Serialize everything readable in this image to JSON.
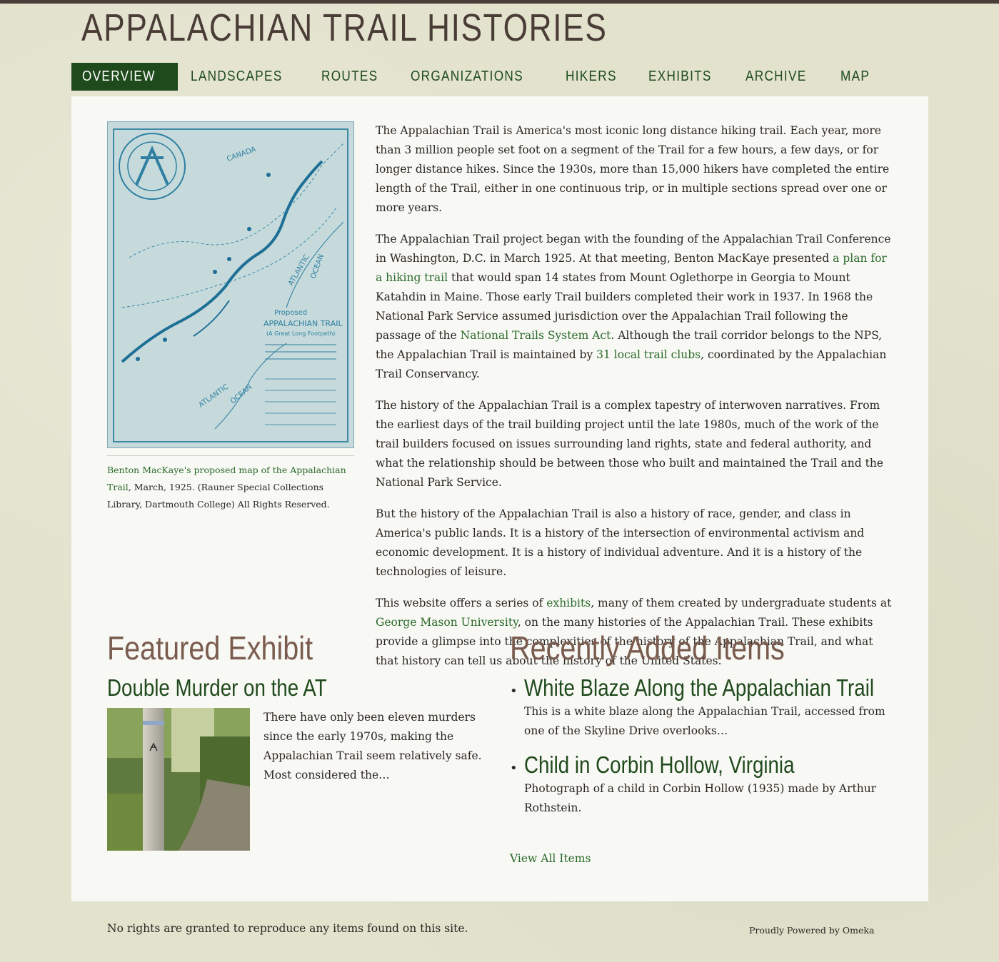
{
  "site": {
    "title": "APPALACHIAN TRAIL HISTORIES"
  },
  "nav": {
    "items": [
      {
        "label": "OVERVIEW"
      },
      {
        "label": "LANDSCAPES"
      },
      {
        "label": "ROUTES"
      },
      {
        "label": "ORGANIZATIONS"
      },
      {
        "label": "HIKERS"
      },
      {
        "label": "EXHIBITS"
      },
      {
        "label": "ARCHIVE"
      },
      {
        "label": "MAP"
      }
    ]
  },
  "map_figure": {
    "map_labels": {
      "canada": "CANADA",
      "proposed": "Proposed",
      "at": "APPALACHIAN TRAIL",
      "subtitle": "(A Great Long Footpath)",
      "atlantic1": "ATLANTIC",
      "ocean1": "OCEAN",
      "atlantic2": "ATLANTIC",
      "ocean2": "OCEAN"
    },
    "caption_link": "Benton MacKaye's proposed map of the Appalachian Trail",
    "caption_rest": ", March, 1925. (Rauner Special Collections Library, Dartmouth College) All Rights Reserved."
  },
  "intro": {
    "p1": "The Appalachian Trail is America's most iconic long distance hiking trail. Each year, more than 3 million people set foot on a segment of the Trail for a few hours, a few days, or for longer distance hikes. Since the 1930s, more than 15,000 hikers have completed the entire length of the Trail, either in one continuous trip, or in multiple sections spread over one or more years.",
    "p2": {
      "a": "The Appalachian Trail project began with the founding of the Appalachian Trail Conference in Washington, D.C. in March 1925. At that meeting, Benton MacKaye presented ",
      "link1": "a plan for a hiking trail",
      "b": " that would span 14 states from Mount Oglethorpe in Georgia to Mount Katahdin in Maine. Those early Trail builders completed their work in 1937. In 1968 the National Park Service assumed jurisdiction over the Appalachian Trail following the passage of the ",
      "link2": "National Trails System Act",
      "c": ". Although the trail corridor belongs to the NPS, the Appalachian Trail is maintained by ",
      "link3": "31 local trail clubs",
      "d": ", coordinated by the Appalachian Trail Conservancy."
    },
    "p3": "The history of the Appalachian Trail is a complex tapestry of interwoven narratives. From the earliest days of the trail building project until the late 1980s, much of the work of the trail builders focused on issues surrounding land rights, state and federal authority, and what the relationship should be between those who built and maintained the Trail and the National Park Service.",
    "p4": "But the history of the Appalachian Trail is also a history of race, gender, and class in America's public lands. It is a history of the intersection of environmental activism and economic development. It is a history of individual adventure. And it is a history of the technologies of leisure.",
    "p5": {
      "a": "This website offers a series of ",
      "link1": "exhibits",
      "b": ", many of them created by undergraduate students at ",
      "link2": "George Mason University",
      "c": ", on the many histories of the Appalachian Trail. These exhibits provide a glimpse into the complexities of the history of the Appalachian Trail, and what that history can tell us about the history of the United States."
    }
  },
  "featured": {
    "heading": "Featured Exhibit",
    "title": "Double Murder on the AT",
    "description": "There have only been eleven murders since the early 1970s, making the Appalachian Trail seem relatively safe. Most considered the…"
  },
  "recent": {
    "heading": "Recently Added Items",
    "items": [
      {
        "title": "White Blaze Along the Appalachian Trail",
        "description": "This is a white blaze along the Appalachian Trail, accessed from one of the Skyline Drive overlooks…"
      },
      {
        "title": "Child in Corbin Hollow, Virginia",
        "description": "Photograph of a child in Corbin Hollow (1935) made by Arthur Rothstein."
      }
    ],
    "view_all": "View All Items"
  },
  "footer": {
    "rights": "No rights are granted to reproduce any items found on this site.",
    "powered": "Proudly Powered by Omeka"
  },
  "colors": {
    "nav_active_bg": "#1f4a1c",
    "link": "#2a6a2a",
    "heading": "#7a5c4f",
    "page_bg": "#e2e2cd"
  }
}
